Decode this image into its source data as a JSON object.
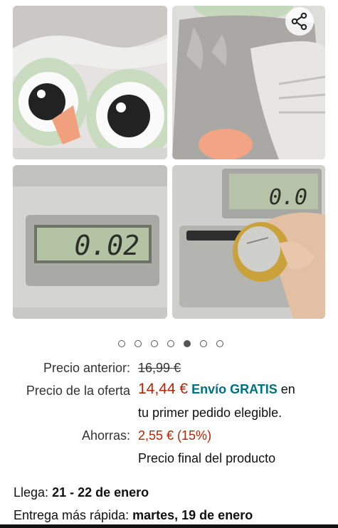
{
  "gallery": {
    "share_icon": "share-icon",
    "display_reading_1": "0.02",
    "display_reading_2": "0.0",
    "dots_total": 7,
    "active_dot_index": 4
  },
  "pricing": {
    "previous_label": "Precio anterior:",
    "previous_value": "16,99 €",
    "offer_label": "Precio de la oferta",
    "offer_value": "14,44 €",
    "shipping": "Envío GRATIS",
    "shipping_tail": "en",
    "shipping_line2": "tu primer pedido elegible.",
    "savings_label": "Ahorras:",
    "savings_value": "2,55 € (15%)",
    "final_note": "Precio final del producto"
  },
  "delivery": {
    "arrives_label": "Llega:",
    "arrives_value": "21 - 22 de enero",
    "fastest_label": "Entrega más rápida:",
    "fastest_value": "martes, 19 de enero"
  },
  "colors": {
    "price_red": "#b12704",
    "link_teal": "#007185"
  }
}
